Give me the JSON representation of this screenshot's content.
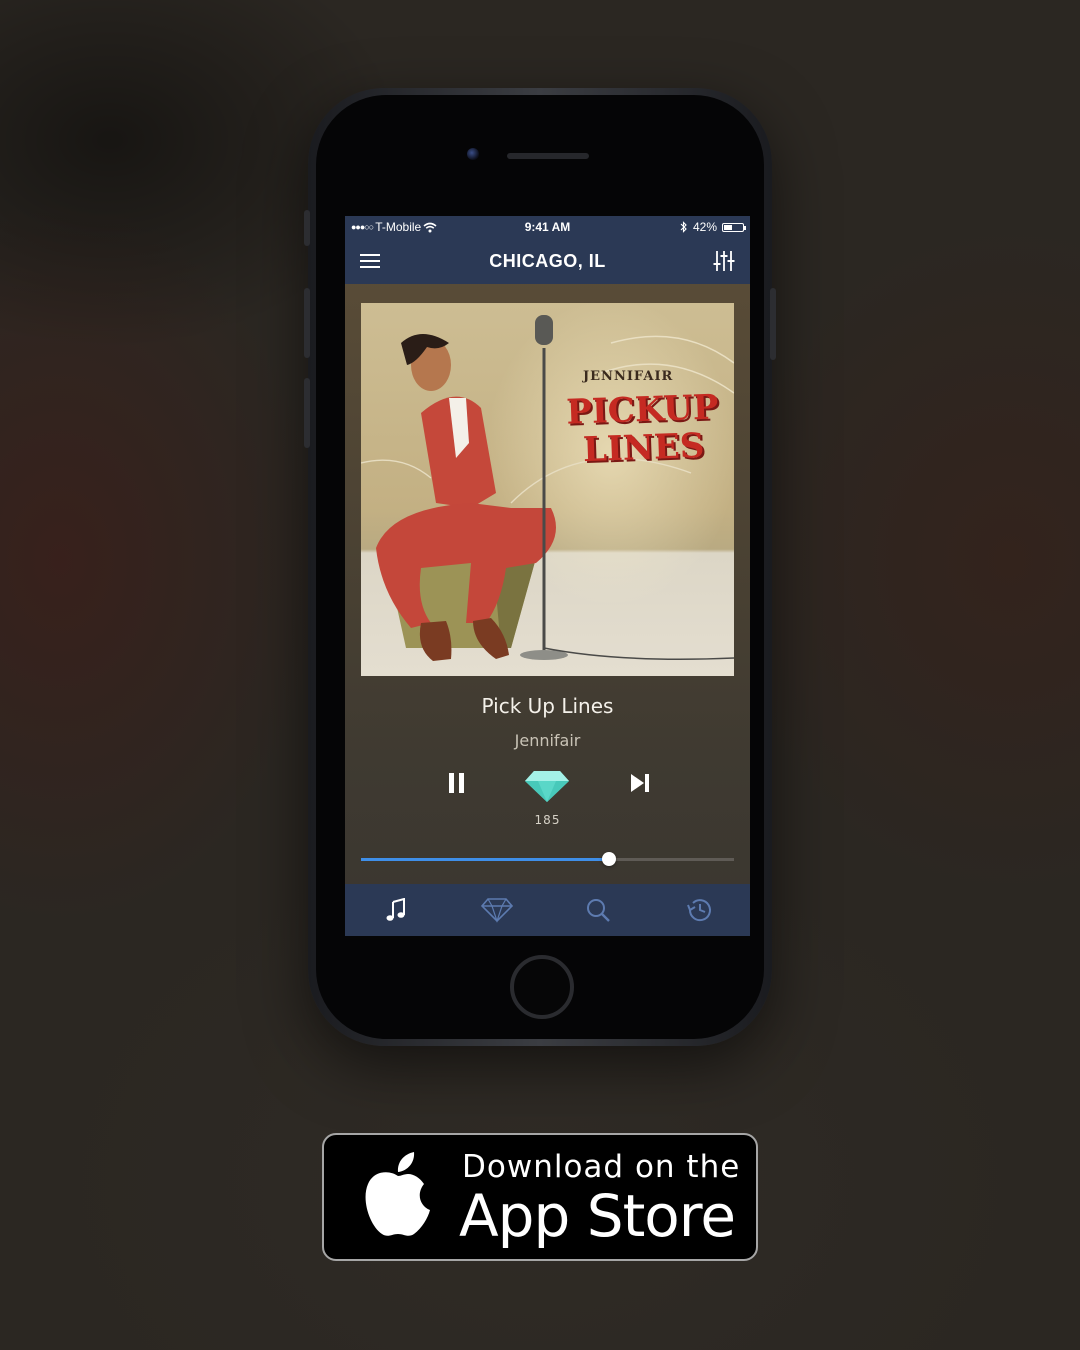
{
  "status_bar": {
    "carrier": "T-Mobile",
    "time": "9:41 AM",
    "battery": "42%",
    "battery_level": 0.42
  },
  "nav": {
    "title": "CHICAGO, IL",
    "menu_icon": "hamburger-menu-icon",
    "settings_icon": "equalizer-sliders-icon"
  },
  "album": {
    "artist_text": "JENNIFAIR",
    "title_text": "PICKUP LINES"
  },
  "now_playing": {
    "title": "Pick Up Lines",
    "artist": "Jennifair",
    "gem_count": "185",
    "progress": 0.665,
    "accent_color": "#3f8fe8",
    "gem_color": "#6fe3d4"
  },
  "tabs": [
    {
      "name": "now-playing",
      "icon": "music-note-icon",
      "active": true
    },
    {
      "name": "gems",
      "icon": "diamond-icon",
      "active": false
    },
    {
      "name": "search",
      "icon": "search-icon",
      "active": false
    },
    {
      "name": "history",
      "icon": "history-icon",
      "active": false
    }
  ],
  "colors": {
    "nav_background": "#2b3955",
    "tab_active": "#34456a",
    "tab_icon_inactive": "#5d7bb0"
  },
  "badge": {
    "line1": "Download on the",
    "line2": "App Store",
    "icon": "apple-logo-icon"
  }
}
